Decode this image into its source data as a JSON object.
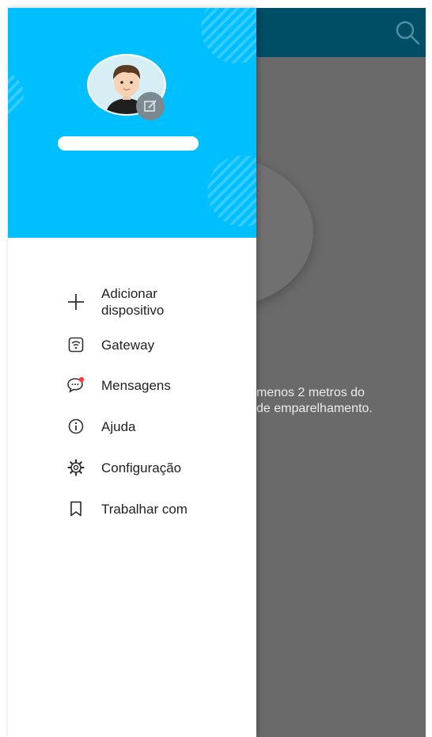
{
  "background": {
    "hint_line1": "menos 2 metros do",
    "hint_line2": "de emparelhamento."
  },
  "drawer": {
    "profile": {
      "name": ""
    },
    "menu": [
      {
        "label": "Adicionar dispositivo",
        "icon": "plus-icon"
      },
      {
        "label": "Gateway",
        "icon": "gateway-icon"
      },
      {
        "label": "Mensagens",
        "icon": "message-icon",
        "has_badge": true
      },
      {
        "label": "Ajuda",
        "icon": "info-icon"
      },
      {
        "label": "Configuração",
        "icon": "gear-icon"
      },
      {
        "label": "Trabalhar com",
        "icon": "bookmark-icon"
      }
    ]
  },
  "colors": {
    "header": "#00bfff",
    "topbar": "#004d66",
    "scrim": "#6a6a6a",
    "badge": "#ff3b3b"
  }
}
